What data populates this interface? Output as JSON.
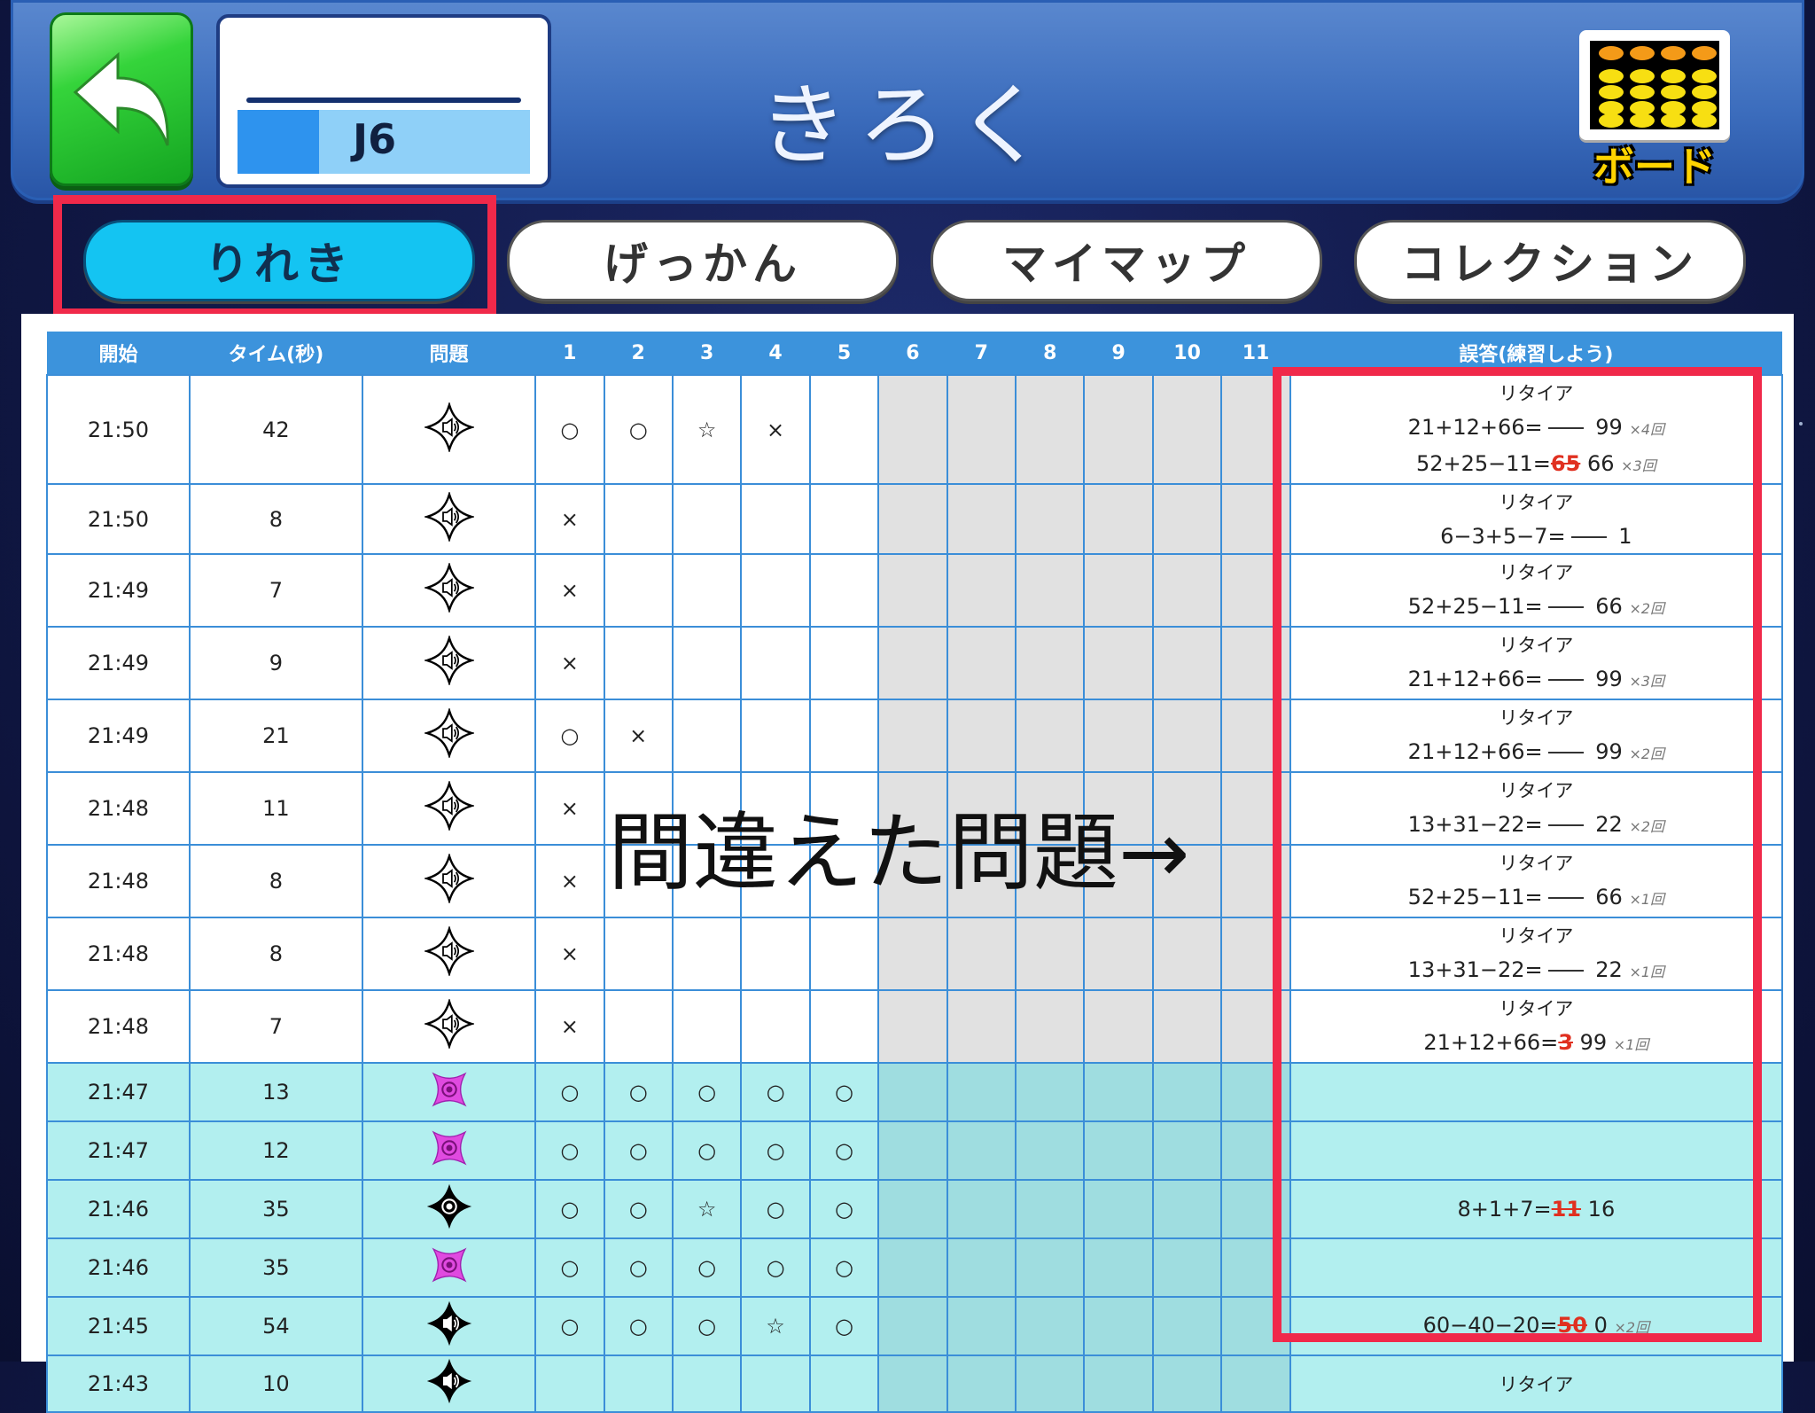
{
  "header": {
    "title": "きろく",
    "level": {
      "name": "J6",
      "progress": 0.28
    },
    "board_label": "ボード"
  },
  "tabs": [
    {
      "label": "りれき",
      "active": true
    },
    {
      "label": "げっかん",
      "active": false
    },
    {
      "label": "マイマップ",
      "active": false
    },
    {
      "label": "コレクション",
      "active": false
    }
  ],
  "table": {
    "headers": [
      "開始",
      "タイム(秒)",
      "問題",
      "1",
      "2",
      "3",
      "4",
      "5",
      "6",
      "7",
      "8",
      "9",
      "10",
      "11",
      "誤答(練習しよう)"
    ],
    "rows": [
      {
        "start": "21:50",
        "time": "42",
        "icon": "speaker-outline",
        "marks": [
          "○",
          "○",
          "☆",
          "×",
          "",
          "",
          "",
          "",
          "",
          "",
          ""
        ],
        "err": [
          {
            "t": "リタイア"
          },
          {
            "q": "21+12+66=",
            "w": "",
            "a": "99",
            "c": "×4回"
          },
          {
            "q": "52+25−11=",
            "w": "65",
            "a": "66",
            "c": "×3回"
          }
        ]
      },
      {
        "start": "21:50",
        "time": "8",
        "icon": "speaker-outline",
        "marks": [
          "×",
          "",
          "",
          "",
          "",
          "",
          "",
          "",
          "",
          "",
          ""
        ],
        "err": [
          {
            "t": "リタイア"
          },
          {
            "q": "6−3+5−7=",
            "w": "",
            "a": "1",
            "c": ""
          }
        ]
      },
      {
        "start": "21:49",
        "time": "7",
        "icon": "speaker-outline",
        "marks": [
          "×",
          "",
          "",
          "",
          "",
          "",
          "",
          "",
          "",
          "",
          ""
        ],
        "err": [
          {
            "t": "リタイア"
          },
          {
            "q": "52+25−11=",
            "w": "",
            "a": "66",
            "c": "×2回"
          }
        ]
      },
      {
        "start": "21:49",
        "time": "9",
        "icon": "speaker-outline",
        "marks": [
          "×",
          "",
          "",
          "",
          "",
          "",
          "",
          "",
          "",
          "",
          ""
        ],
        "err": [
          {
            "t": "リタイア"
          },
          {
            "q": "21+12+66=",
            "w": "",
            "a": "99",
            "c": "×3回"
          }
        ]
      },
      {
        "start": "21:49",
        "time": "21",
        "icon": "speaker-outline",
        "marks": [
          "○",
          "×",
          "",
          "",
          "",
          "",
          "",
          "",
          "",
          "",
          ""
        ],
        "err": [
          {
            "t": "リタイア"
          },
          {
            "q": "21+12+66=",
            "w": "",
            "a": "99",
            "c": "×2回"
          }
        ]
      },
      {
        "start": "21:48",
        "time": "11",
        "icon": "speaker-outline",
        "marks": [
          "×",
          "",
          "",
          "",
          "",
          "",
          "",
          "",
          "",
          "",
          ""
        ],
        "err": [
          {
            "t": "リタイア"
          },
          {
            "q": "13+31−22=",
            "w": "",
            "a": "22",
            "c": "×2回"
          }
        ]
      },
      {
        "start": "21:48",
        "time": "8",
        "icon": "speaker-outline",
        "marks": [
          "×",
          "",
          "",
          "",
          "",
          "",
          "",
          "",
          "",
          "",
          ""
        ],
        "err": [
          {
            "t": "リタイア"
          },
          {
            "q": "52+25−11=",
            "w": "",
            "a": "66",
            "c": "×1回"
          }
        ]
      },
      {
        "start": "21:48",
        "time": "8",
        "icon": "speaker-outline",
        "marks": [
          "×",
          "",
          "",
          "",
          "",
          "",
          "",
          "",
          "",
          "",
          ""
        ],
        "err": [
          {
            "t": "リタイア"
          },
          {
            "q": "13+31−22=",
            "w": "",
            "a": "22",
            "c": "×1回"
          }
        ]
      },
      {
        "start": "21:48",
        "time": "7",
        "icon": "speaker-outline",
        "marks": [
          "×",
          "",
          "",
          "",
          "",
          "",
          "",
          "",
          "",
          "",
          ""
        ],
        "err": [
          {
            "t": "リタイア"
          },
          {
            "q": "21+12+66=",
            "w": "3",
            "a": "99",
            "c": "×1回"
          }
        ]
      },
      {
        "start": "21:47",
        "time": "13",
        "icon": "target-magenta",
        "marks": [
          "○",
          "○",
          "○",
          "○",
          "○",
          "",
          "",
          "",
          "",
          "",
          ""
        ],
        "err": [],
        "blue": true
      },
      {
        "start": "21:47",
        "time": "12",
        "icon": "target-magenta",
        "marks": [
          "○",
          "○",
          "○",
          "○",
          "○",
          "",
          "",
          "",
          "",
          "",
          ""
        ],
        "err": [],
        "blue": true
      },
      {
        "start": "21:46",
        "time": "35",
        "icon": "target-black",
        "marks": [
          "○",
          "○",
          "☆",
          "○",
          "○",
          "",
          "",
          "",
          "",
          "",
          ""
        ],
        "err": [
          {
            "q": "8+1+7=",
            "w": "11",
            "a": "16",
            "c": ""
          }
        ],
        "blue": true
      },
      {
        "start": "21:46",
        "time": "35",
        "icon": "target-magenta",
        "marks": [
          "○",
          "○",
          "○",
          "○",
          "○",
          "",
          "",
          "",
          "",
          "",
          ""
        ],
        "err": [],
        "blue": true
      },
      {
        "start": "21:45",
        "time": "54",
        "icon": "speaker-black",
        "marks": [
          "○",
          "○",
          "○",
          "☆",
          "○",
          "",
          "",
          "",
          "",
          "",
          ""
        ],
        "err": [
          {
            "q": "60−40−20=",
            "w": "50",
            "a": "0",
            "c": "×2回"
          }
        ],
        "blue": true
      },
      {
        "start": "21:43",
        "time": "10",
        "icon": "speaker-black",
        "marks": [
          "",
          "",
          "",
          "",
          "",
          "",
          "",
          "",
          "",
          "",
          ""
        ],
        "err": [
          {
            "t": "リタイア"
          }
        ],
        "blue": true
      }
    ]
  },
  "annotation": "間違えた問題→",
  "colors": {
    "highlight": "#f0294a",
    "header_blue": "#3c93dc",
    "tab_active": "#14c4f2",
    "back_green": "#35d43b"
  }
}
